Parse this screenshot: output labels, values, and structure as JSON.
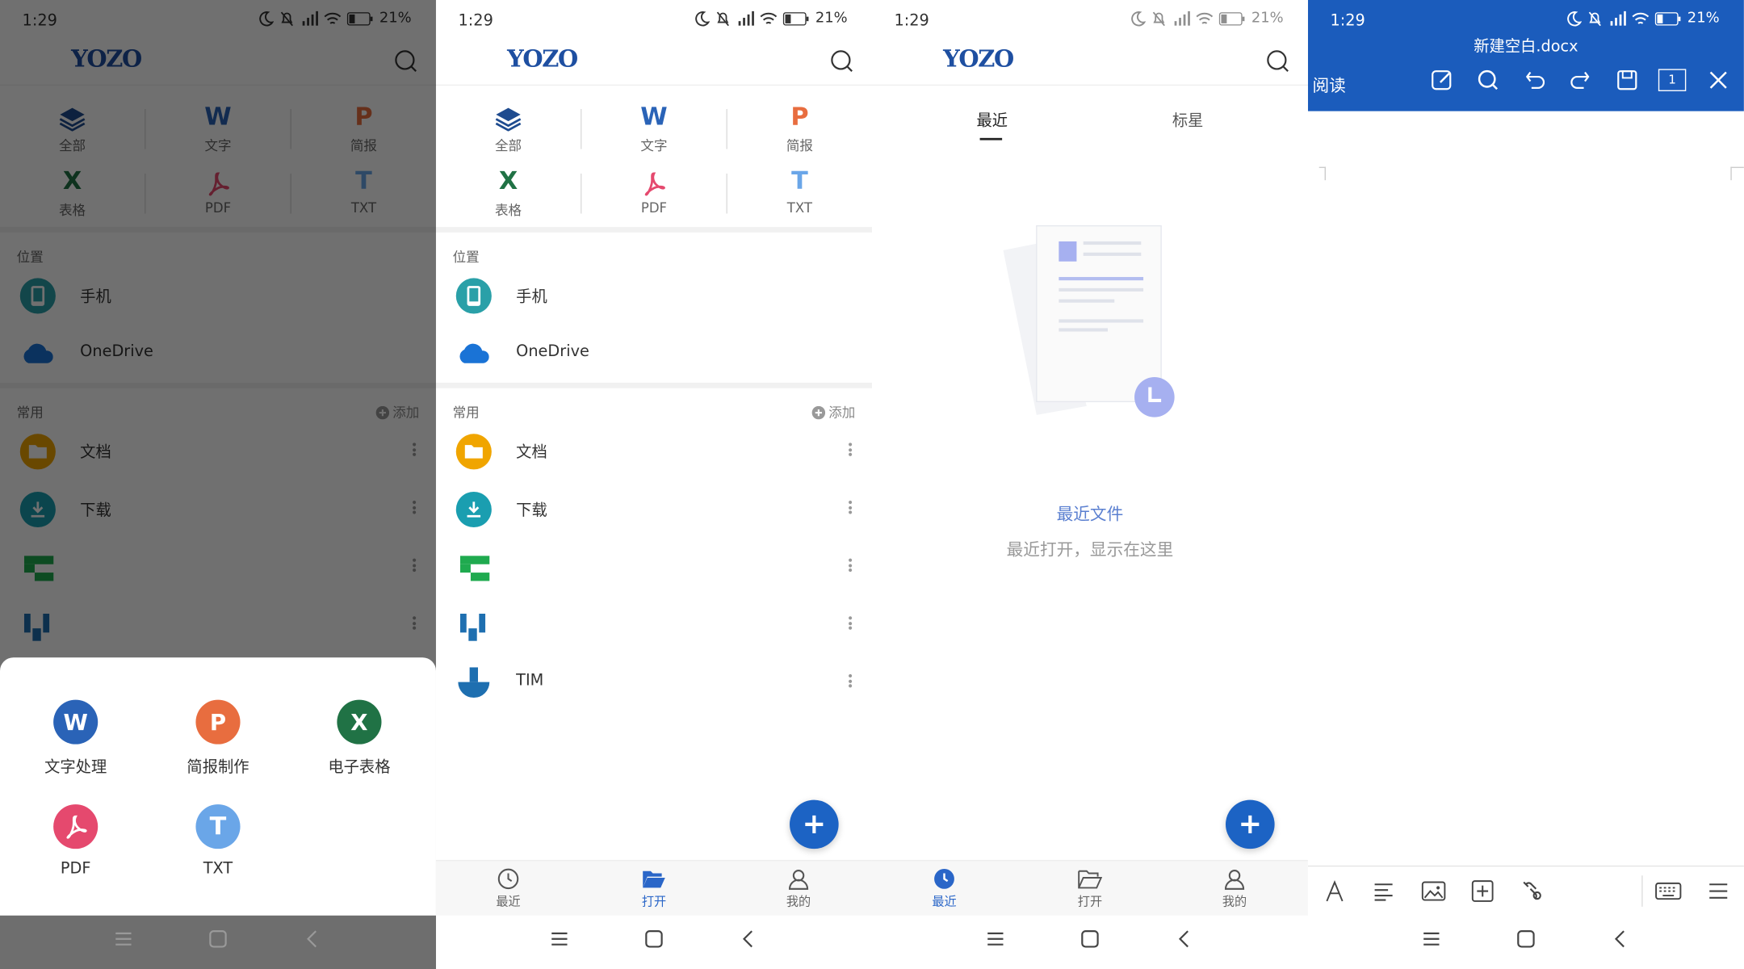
{
  "status": {
    "time": "1:29",
    "battery": "21%"
  },
  "app": {
    "logo": "YOZO"
  },
  "categories": [
    {
      "label": "全部",
      "icon": "layers-icon"
    },
    {
      "label": "文字",
      "icon": "word-icon"
    },
    {
      "label": "简报",
      "icon": "presentation-icon"
    },
    {
      "label": "表格",
      "icon": "spreadsheet-icon"
    },
    {
      "label": "PDF",
      "icon": "pdf-icon"
    },
    {
      "label": "TXT",
      "icon": "txt-icon"
    }
  ],
  "location": {
    "title": "位置",
    "items": [
      {
        "label": "手机",
        "icon": "phone-icon"
      },
      {
        "label": "OneDrive",
        "icon": "cloud-icon"
      }
    ]
  },
  "common": {
    "title": "常用",
    "add_label": "添加",
    "items": [
      {
        "label": "文档",
        "icon": "folder-icon"
      },
      {
        "label": "下载",
        "icon": "download-icon"
      },
      {
        "label": "",
        "icon": "app-icon"
      },
      {
        "label": "",
        "icon": "app-icon"
      },
      {
        "label": "TIM",
        "icon": "tim-icon"
      }
    ]
  },
  "new_sheet": {
    "items": [
      {
        "label": "文字处理",
        "color": "#2a63b7",
        "icon": "word-icon"
      },
      {
        "label": "简报制作",
        "color": "#e86d3f",
        "icon": "presentation-icon"
      },
      {
        "label": "电子表格",
        "color": "#207245",
        "icon": "spreadsheet-icon"
      },
      {
        "label": "PDF",
        "color": "#e5496e",
        "icon": "pdf-icon"
      },
      {
        "label": "TXT",
        "color": "#6aa6e8",
        "icon": "txt-icon"
      }
    ]
  },
  "tabs": [
    {
      "label": "最近",
      "icon": "clock-icon"
    },
    {
      "label": "打开",
      "icon": "folder-open-icon"
    },
    {
      "label": "我的",
      "icon": "user-icon"
    }
  ],
  "recent": {
    "tabs": [
      "最近",
      "标星"
    ],
    "empty_title": "最近文件",
    "empty_desc": "最近打开，显示在这里"
  },
  "editor": {
    "title": "新建空白.docx",
    "mode": "阅读",
    "page_number": "1"
  },
  "colors": {
    "brand": "#1b5cbc",
    "accent": "#2a66c8"
  }
}
